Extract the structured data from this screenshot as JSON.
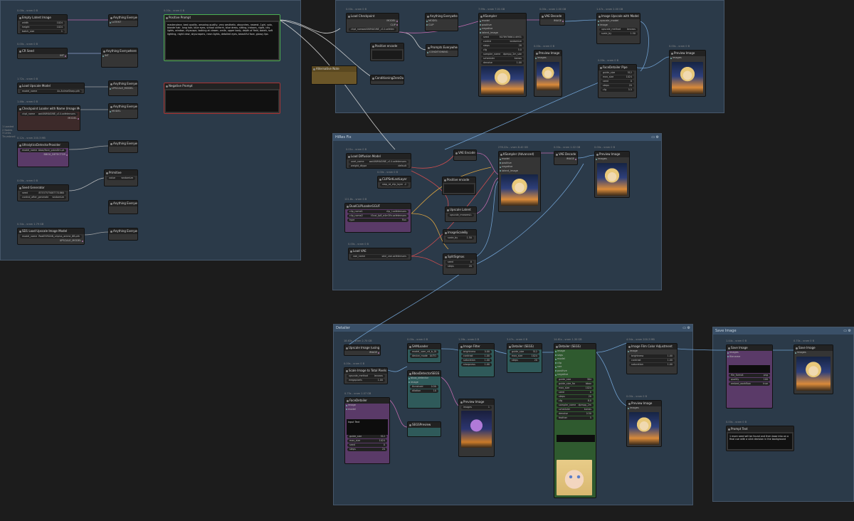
{
  "groups": {
    "g1": {
      "title": ""
    },
    "g2": {
      "title": ""
    },
    "hires": {
      "title": "HiRes Fix"
    },
    "detailer": {
      "title": "Detailer"
    },
    "save": {
      "title": "Save Image"
    }
  },
  "side_note": [
    "1 Loaded",
    "2 Nodes",
    "3 Links",
    "Thumbnail"
  ],
  "nodes": {
    "load_latent": {
      "badge": "0.00s - vram 0 B",
      "title": "Empty Latent Image",
      "widgets": [
        [
          "width",
          "1024"
        ],
        [
          "height",
          "1024"
        ],
        [
          "batch_size",
          "1"
        ]
      ],
      "out": "LATENT"
    },
    "seed": {
      "badge": "0.00s - vram 0 B",
      "title": "CR Seed",
      "widgets": [
        [
          "seed",
          "0"
        ]
      ],
      "out": "INT"
    },
    "lora": {
      "badge": "1.72s - vram 0 B",
      "title": "Load Upscale Model",
      "widgets": [
        [
          "model_name",
          "4x-AnimeSharp.pth"
        ]
      ],
      "out": "UPSCALE_MODEL"
    },
    "checkpoint": {
      "badge": "1.46s - vram 0 B",
      "title": "Checkpoint Loader with Name (Image Metadata)",
      "widgets": [
        [
          "ckpt_name",
          "waiANIMAGINE_v14.safetensors"
        ]
      ],
      "out": "MODEL"
    },
    "ultraseg": {
      "badge": "0.12s - vram 200.3 MB",
      "title": "UltralyticsDetectorProvider",
      "widgets": [
        [
          "model_name",
          "bbox/face_yolov8m.pt"
        ]
      ],
      "out": "BBOX_DETECTOR"
    },
    "sampler_cfg": {
      "badge": "0.00s - vram 0 B",
      "title": "Seed Generator",
      "widgets": [
        [
          "seed",
          "87537575087731860"
        ],
        [
          "control_after_generate",
          "randomize"
        ]
      ],
      "out": "INT"
    },
    "upscale_model2": {
      "badge": "0.34s - vram 1.79 GB",
      "title": "SD1 Load Upscale Image Model",
      "widgets": [
        [
          "model_name",
          "RealESRGAN_x4plus_anime_6B.pth"
        ]
      ],
      "out": "UPSCALE_MODEL"
    },
    "pos_prompt": {
      "badge": "0.00s - vram 0 B",
      "title": "Positive Prompt",
      "text": "masterpiece, best quality, amazing quality, very aesthetic, absurdres, newest, 1girl, solo, blonde hair, long hair, blue eyes, school uniform, blue dress, sitting, indoors, night, city lights, window, cityscape, looking at viewer, smile, upper body, depth of field, bokeh, soft lighting, night view, skyscrapers, neon lights, detailed eyes, beautiful face, glossy lips"
    },
    "neg_prompt": {
      "badge": "",
      "title": "Negative Prompt",
      "text": ""
    },
    "gate": {
      "title": "Alternative Note"
    },
    "load_ckpt_top": {
      "badge": "0.00s - vram 0 B",
      "title": "Load Checkpoint",
      "widgets": [
        [
          "ckpt_name",
          "waiANIMAGINE_v14.safetensors"
        ]
      ],
      "out": "MODEL"
    },
    "ksampler": {
      "badge": "7.99s - vram 7.01 GB",
      "title": "KSampler",
      "widgets": [
        [
          "seed",
          "807897866116931"
        ],
        [
          "control",
          "randomize"
        ],
        [
          "steps",
          "28"
        ],
        [
          "cfg",
          "5.0"
        ],
        [
          "sampler_name",
          "dpmpp_2m_sde"
        ],
        [
          "scheduler",
          "karras"
        ],
        [
          "denoise",
          "1.00"
        ]
      ]
    },
    "vae_decode": {
      "badge": "0.00s - vram 1.00 GB",
      "title": "VAE Decode",
      "out": "IMAGE"
    },
    "upscale_img": {
      "badge": "1.47s - vram 2.00 GB",
      "title": "Image Upscale with Model",
      "widgets": [
        [
          "upscale_method",
          "lanczos"
        ],
        [
          "scale_by",
          "1.50"
        ]
      ]
    },
    "preview1": {
      "badge": "0.00s - vram 0 B",
      "title": "Preview Image"
    },
    "preview2": {
      "badge": "0.00s - vram 0 B",
      "title": "Preview Image"
    },
    "facedetailer1": {
      "badge": "0.00s - vram 0 B",
      "title": "FaceDetailer Pipe",
      "widgets": [
        [
          "guide_size",
          "512"
        ],
        [
          "max_size",
          "1024"
        ],
        [
          "seed",
          "0"
        ],
        [
          "steps",
          "20"
        ],
        [
          "cfg",
          "5.5"
        ],
        [
          "denoise",
          "0.40"
        ]
      ]
    },
    "hr_loader": {
      "badge": "0.01s - vram 0 B",
      "title": "Load Diffusion Model",
      "widgets": [
        [
          "unet_name",
          "waiANIMAGINE_v14.safetensors"
        ],
        [
          "weight_dtype",
          "default"
        ]
      ]
    },
    "hr_clip": {
      "badge": "0.00s - vram 0 B",
      "title": "CLIPSetLastLayer",
      "widgets": [
        [
          "stop_at_clip_layer",
          "-2"
        ]
      ]
    },
    "hr_text_encode": {
      "badge": "121.8s - vram 0 B",
      "title": "DualCLIPLoaderGGUF",
      "widgets": [
        [
          "clip_name1",
          "clip_l.safetensors"
        ],
        [
          "clip_name2",
          "t5xxl_fp8_e4m3fn.safetensors"
        ],
        [
          "type",
          "flux"
        ]
      ]
    },
    "hr_vae": {
      "badge": "0.00s - vram 0 B",
      "title": "Load VAE",
      "widgets": [
        [
          "vae_name",
          "sdxl_vae.safetensors"
        ]
      ]
    },
    "hr_ksampler": {
      "badge": "278.22s - vram 8.40 GB",
      "title": "KSampler (Advanced)",
      "widgets": [
        [
          "add_noise",
          "enable"
        ],
        [
          "noise_seed",
          "0"
        ],
        [
          "steps",
          "20"
        ],
        [
          "cfg",
          "5.0"
        ],
        [
          "sampler_name",
          "euler"
        ],
        [
          "scheduler",
          "normal"
        ]
      ]
    },
    "hr_vae_decode": {
      "badge": "0.00s - vram 1.02 GB",
      "title": "VAE Decode",
      "out": "IMAGE"
    },
    "hr_preview": {
      "badge": "0.00s - vram 0 B",
      "title": "Preview Image"
    },
    "hr_latent_up": {
      "badge": "0.00s - vram 0 B",
      "title": "Upscale Latent",
      "widgets": [
        [
          "upscale_method",
          "nearest-exact"
        ],
        [
          "scale_by",
          "1.50"
        ]
      ]
    },
    "hr_empty": {
      "badge": "0.00s - vram 0 B",
      "title": "ImageScaleBy",
      "widgets": [
        [
          "upscale_method",
          "lanczos"
        ],
        [
          "scale_by",
          "1.50"
        ]
      ]
    },
    "det_upscale": {
      "badge": "18.63s - vram 2.70 GB",
      "title": "Upscale Image (using Model)",
      "out": "IMAGE"
    },
    "det_scale": {
      "badge": "0.00s - vram 0 B",
      "title": "Scale Image to Total Pixels",
      "widgets": [
        [
          "upscale_method",
          "lanczos"
        ],
        [
          "megapixels",
          "1.00"
        ]
      ]
    },
    "det_text": {
      "badge": "0.75s - vram 1.07 GB",
      "title": "FaceDetailer",
      "text": "Input Text"
    },
    "det_sam": {
      "badge": "0.00s - vram 0 B",
      "title": "SAMLoader",
      "widgets": [
        [
          "model_name",
          "sam_vit_b_01ec64.pth"
        ],
        [
          "device_mode",
          "AUTO"
        ]
      ]
    },
    "det_bbox": {
      "badge": "0.00s - vram 0 B",
      "title": "BboxDetectorSEGS",
      "widgets": [
        [
          "threshold",
          "0.50"
        ],
        [
          "dilation",
          "10"
        ]
      ]
    },
    "det_filter": {
      "badge": "1.26s - vram 0 B",
      "title": "Image Filter",
      "widgets": [
        [
          "brightness",
          "0.00"
        ],
        [
          "contrast",
          "1.00"
        ],
        [
          "saturation",
          "1.00"
        ],
        [
          "sharpness",
          "1.00"
        ]
      ]
    },
    "det_detailer": {
      "badge": "3.47s - vram 0 B",
      "title": "Detailer (SEGS)",
      "widgets": [
        [
          "guide_size",
          "512"
        ],
        [
          "max_size",
          "1024"
        ],
        [
          "steps",
          "20"
        ]
      ]
    },
    "det_main": {
      "badge": "14.61s - vram 1.30 GB",
      "title": "Detailer (SEGS)",
      "widgets": [
        [
          "guide_size",
          "384"
        ],
        [
          "guide_size_for",
          "bbox"
        ],
        [
          "max_size",
          "1024"
        ],
        [
          "seed",
          "0"
        ],
        [
          "steps",
          "20"
        ],
        [
          "cfg",
          "8.0"
        ],
        [
          "sampler_name",
          "dpmpp_2m"
        ],
        [
          "scheduler",
          "karras"
        ],
        [
          "denoise",
          "0.50"
        ],
        [
          "feather",
          "5"
        ]
      ]
    },
    "det_preview": {
      "badge": "0.00s - vram 0 B",
      "title": "Preview Image"
    },
    "det_color": {
      "badge": "4.94s - vram 200.3 MB",
      "title": "Image Film Color Adjustment",
      "widgets": [
        [
          "brightness",
          "1.00"
        ],
        [
          "contrast",
          "1.00"
        ],
        [
          "saturation",
          "1.00"
        ]
      ]
    },
    "det_preview2": {
      "badge": "0.00s - vram 0 B",
      "title": "Preview Image"
    },
    "save_node": {
      "badge": "1.44s - vram 0 B",
      "title": "Save Image",
      "widgets": [
        [
          "filename_prefix",
          "ComfyUI"
        ]
      ]
    },
    "save_preview": {
      "badge": "0.70s - vram 0 B",
      "title": "Save Image"
    },
    "save_note": {
      "badge": "0.00s - vram 0 B",
      "title": "Prompt Text",
      "text": "1 more seed will be found and then base into on a final cue with a slick decision in the background"
    }
  }
}
